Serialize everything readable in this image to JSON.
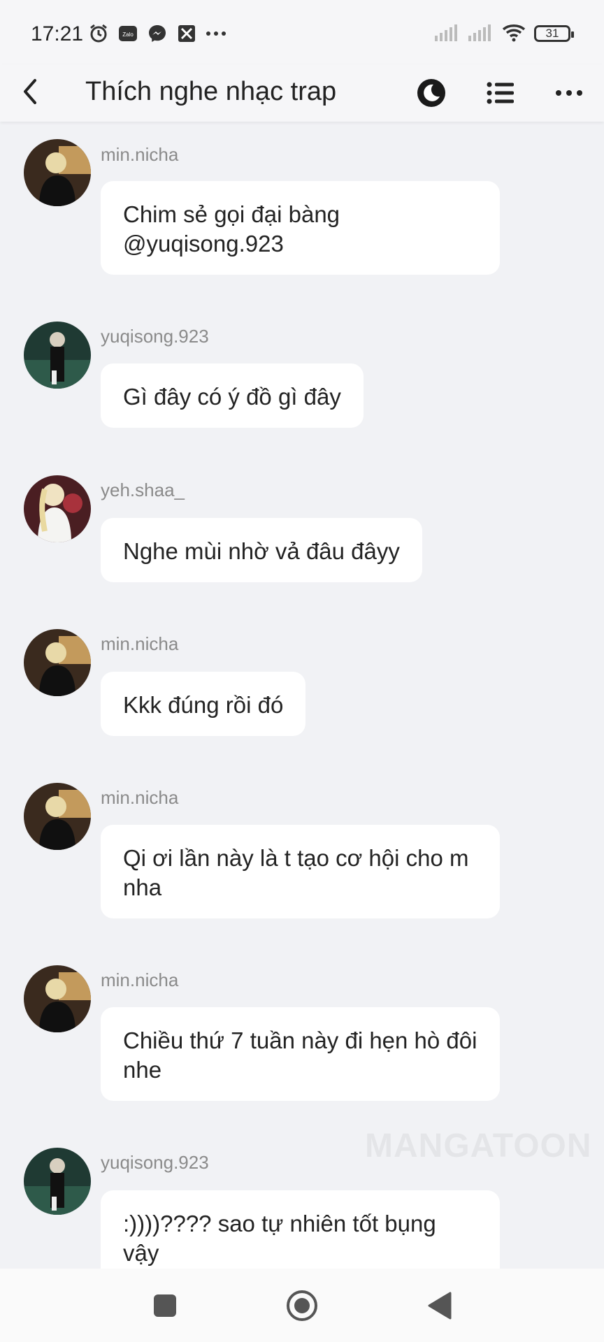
{
  "status_bar": {
    "time": "17:21",
    "icons": [
      "alarm-icon",
      "zalo-icon",
      "messenger-icon",
      "app-icon",
      "more-dots-icon"
    ],
    "right_icons": [
      "signal-icon",
      "signal-icon",
      "wifi-icon",
      "battery-icon"
    ],
    "battery": "31"
  },
  "header": {
    "title": "Thích nghe nhạc trap",
    "icons": [
      "back-icon",
      "night-mode-icon",
      "list-icon",
      "more-icon"
    ]
  },
  "messages": [
    {
      "user": "min.nicha",
      "text": "Chim sẻ gọi đại bàng\n@yuqisong.923"
    },
    {
      "user": "yuqisong.923",
      "text": "Gì đây có ý đồ gì đây"
    },
    {
      "user": "yeh.shaa_",
      "text": "Nghe mùi nhờ vả đâu đâyy"
    },
    {
      "user": "min.nicha",
      "text": "Kkk đúng rồi đó"
    },
    {
      "user": "min.nicha",
      "text": "Qi ơi lần này là t tạo cơ hội cho m nha"
    },
    {
      "user": "min.nicha",
      "text": "Chiều thứ 7 tuần này đi hẹn hò đôi nhe"
    },
    {
      "user": "yuqisong.923",
      "text": ":))))???? sao tự nhiên tốt bụng vậy"
    }
  ],
  "watermark": "MANGATOON",
  "colors": {
    "background": "#f1f2f5",
    "bubble": "#ffffff",
    "username": "#8a8a8a"
  },
  "nav_bar": {
    "icons": [
      "recents-icon",
      "home-icon",
      "back-triangle-icon"
    ]
  }
}
